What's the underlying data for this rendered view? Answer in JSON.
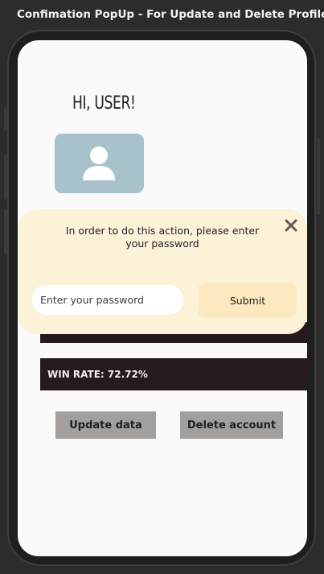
{
  "frame": {
    "title": "Confimation PopUp - For Update and Delete Profile"
  },
  "profile": {
    "greeting": "HI, USER!",
    "avatar_icon": "user-icon"
  },
  "stats": {
    "win_rate_label": "WIN RATE: 72.72%"
  },
  "actions": {
    "update_label": "Update data",
    "delete_label": "Delete account"
  },
  "popup": {
    "message": "In order to do this action, please enter your password",
    "password_placeholder": "Enter your password",
    "password_value": "",
    "submit_label": "Submit",
    "close_icon": "close-icon"
  },
  "colors": {
    "background": "#2c2c2c",
    "screen": "#fafafa",
    "popup": "#fcf2d8",
    "submit": "#fde9bf",
    "stat_bar": "#241a1f",
    "button": "#a39f9d",
    "avatar": "#a8c2cc"
  }
}
